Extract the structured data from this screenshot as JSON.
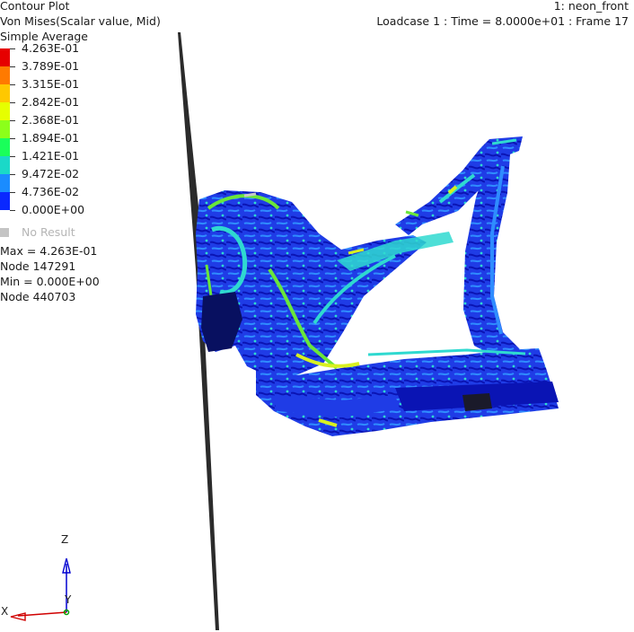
{
  "header_left": {
    "line1": "Contour Plot",
    "line2": "Von Mises(Scalar value, Mid)",
    "line3": "Simple Average"
  },
  "header_right": {
    "line1": "1: neon_front",
    "line2": "Loadcase 1 : Time = 8.0000e+01 : Frame 17"
  },
  "legend": {
    "levels": [
      {
        "label": "4.263E-01",
        "color": "#e60000"
      },
      {
        "label": "3.789E-01",
        "color": "#ff7a00"
      },
      {
        "label": "3.315E-01",
        "color": "#ffc800"
      },
      {
        "label": "2.842E-01",
        "color": "#e6ff00"
      },
      {
        "label": "2.368E-01",
        "color": "#8cff1a"
      },
      {
        "label": "1.894E-01",
        "color": "#1aff5a"
      },
      {
        "label": "1.421E-01",
        "color": "#1ad9c8"
      },
      {
        "label": "9.472E-02",
        "color": "#1a8cff"
      },
      {
        "label": "4.736E-02",
        "color": "#0a28ff"
      },
      {
        "label": "0.000E+00",
        "color": "#0000c8"
      }
    ],
    "no_result": "No Result"
  },
  "stats": {
    "max_line": "Max =  4.263E-01",
    "max_node": "Node 147291",
    "min_line": "Min =  0.000E+00",
    "min_node": "Node 440703"
  },
  "axes": {
    "z": "Z",
    "y": "Y",
    "x": "X"
  },
  "model": {
    "colors": {
      "base": "#1f3ce6",
      "dark": "#0a14b4",
      "mid": "#2f8cff",
      "cyan": "#2fd9d0",
      "green": "#6ae63a",
      "yellow": "#d8f020",
      "barrier": "#2b2b2b"
    }
  }
}
